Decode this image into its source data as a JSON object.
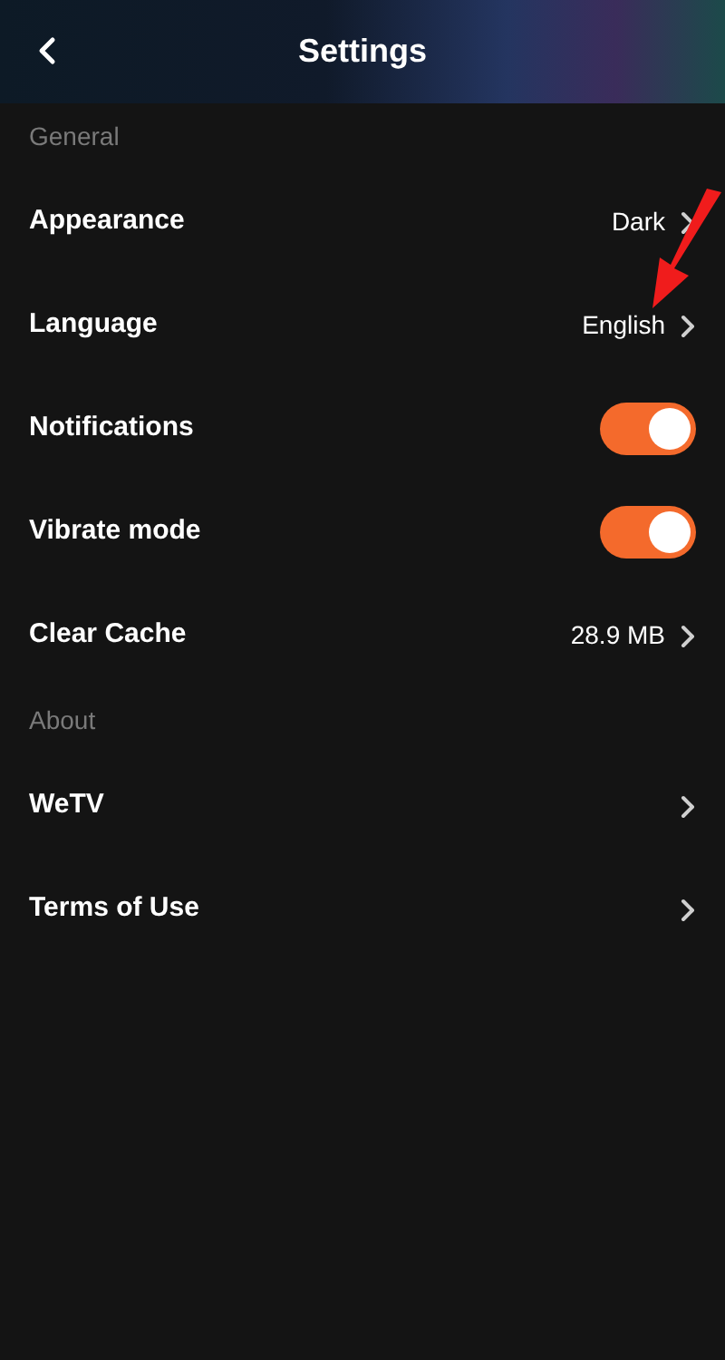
{
  "header": {
    "title": "Settings"
  },
  "sections": [
    {
      "title": "General",
      "items": [
        {
          "kind": "link",
          "label": "Appearance",
          "value": "Dark"
        },
        {
          "kind": "link",
          "label": "Language",
          "value": "English"
        },
        {
          "kind": "toggle",
          "label": "Notifications",
          "on": true
        },
        {
          "kind": "toggle",
          "label": "Vibrate mode",
          "on": true
        },
        {
          "kind": "link",
          "label": "Clear Cache",
          "value": "28.9 MB"
        }
      ]
    },
    {
      "title": "About",
      "items": [
        {
          "kind": "link",
          "label": "WeTV"
        },
        {
          "kind": "link",
          "label": "Terms of Use"
        }
      ]
    }
  ]
}
